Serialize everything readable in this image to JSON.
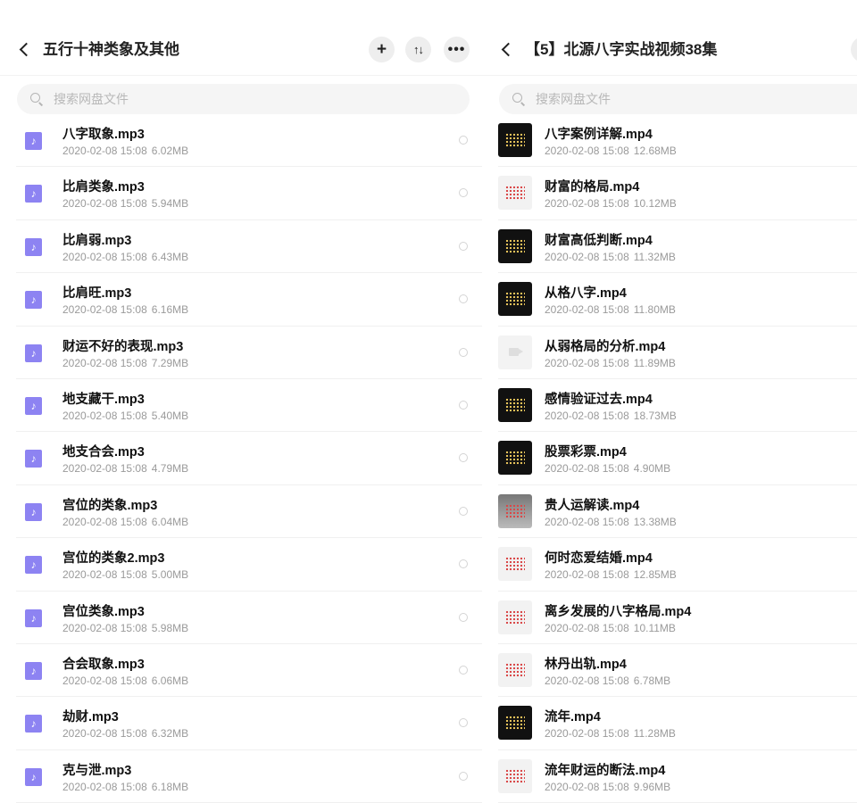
{
  "left": {
    "title": "五行十神类象及其他",
    "add_label": "+",
    "sort_label": "↑↓",
    "more_label": "•••",
    "search_placeholder": "搜索网盘文件",
    "items": [
      {
        "name": "八字取象.mp3",
        "date": "2020-02-08",
        "time": "15:08",
        "size": "6.02MB"
      },
      {
        "name": "比肩类象.mp3",
        "date": "2020-02-08",
        "time": "15:08",
        "size": "5.94MB"
      },
      {
        "name": "比肩弱.mp3",
        "date": "2020-02-08",
        "time": "15:08",
        "size": "6.43MB"
      },
      {
        "name": "比肩旺.mp3",
        "date": "2020-02-08",
        "time": "15:08",
        "size": "6.16MB"
      },
      {
        "name": "财运不好的表现.mp3",
        "date": "2020-02-08",
        "time": "15:08",
        "size": "7.29MB"
      },
      {
        "name": "地支藏干.mp3",
        "date": "2020-02-08",
        "time": "15:08",
        "size": "5.40MB"
      },
      {
        "name": "地支合会.mp3",
        "date": "2020-02-08",
        "time": "15:08",
        "size": "4.79MB"
      },
      {
        "name": "宫位的类象.mp3",
        "date": "2020-02-08",
        "time": "15:08",
        "size": "6.04MB"
      },
      {
        "name": "宫位的类象2.mp3",
        "date": "2020-02-08",
        "time": "15:08",
        "size": "5.00MB"
      },
      {
        "name": "宫位类象.mp3",
        "date": "2020-02-08",
        "time": "15:08",
        "size": "5.98MB"
      },
      {
        "name": "合会取象.mp3",
        "date": "2020-02-08",
        "time": "15:08",
        "size": "6.06MB"
      },
      {
        "name": "劫财.mp3",
        "date": "2020-02-08",
        "time": "15:08",
        "size": "6.32MB"
      },
      {
        "name": "克与泄.mp3",
        "date": "2020-02-08",
        "time": "15:08",
        "size": "6.18MB"
      }
    ]
  },
  "right": {
    "title": "【5】北源八字实战视频38集",
    "search_placeholder": "搜索网盘文件",
    "items": [
      {
        "name": "八字案例详解.mp4",
        "date": "2020-02-08",
        "time": "15:08",
        "size": "12.68MB",
        "thumb": "dark"
      },
      {
        "name": "财富的格局.mp4",
        "date": "2020-02-08",
        "time": "15:08",
        "size": "10.12MB",
        "thumb": "light"
      },
      {
        "name": "财富高低判断.mp4",
        "date": "2020-02-08",
        "time": "15:08",
        "size": "11.32MB",
        "thumb": "dark"
      },
      {
        "name": "从格八字.mp4",
        "date": "2020-02-08",
        "time": "15:08",
        "size": "11.80MB",
        "thumb": "dark"
      },
      {
        "name": "从弱格局的分析.mp4",
        "date": "2020-02-08",
        "time": "15:08",
        "size": "11.89MB",
        "thumb": "empty"
      },
      {
        "name": "感情验证过去.mp4",
        "date": "2020-02-08",
        "time": "15:08",
        "size": "18.73MB",
        "thumb": "dark"
      },
      {
        "name": "股票彩票.mp4",
        "date": "2020-02-08",
        "time": "15:08",
        "size": "4.90MB",
        "thumb": "dark"
      },
      {
        "name": "贵人运解读.mp4",
        "date": "2020-02-08",
        "time": "15:08",
        "size": "13.38MB",
        "thumb": "grey"
      },
      {
        "name": "何时恋爱结婚.mp4",
        "date": "2020-02-08",
        "time": "15:08",
        "size": "12.85MB",
        "thumb": "light"
      },
      {
        "name": "离乡发展的八字格局.mp4",
        "date": "2020-02-08",
        "time": "15:08",
        "size": "10.11MB",
        "thumb": "light"
      },
      {
        "name": "林丹出轨.mp4",
        "date": "2020-02-08",
        "time": "15:08",
        "size": "6.78MB",
        "thumb": "light"
      },
      {
        "name": "流年.mp4",
        "date": "2020-02-08",
        "time": "15:08",
        "size": "11.28MB",
        "thumb": "dark"
      },
      {
        "name": "流年财运的断法.mp4",
        "date": "2020-02-08",
        "time": "15:08",
        "size": "9.96MB",
        "thumb": "light"
      }
    ]
  }
}
